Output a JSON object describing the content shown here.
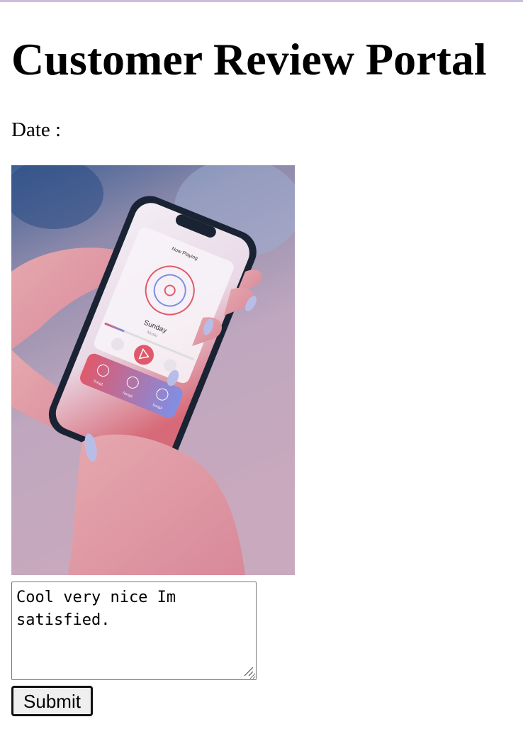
{
  "page": {
    "title": "Customer Review Portal",
    "date_label": "Date :",
    "date_value": ""
  },
  "product_image": {
    "alt": "Hands holding a smartphone showing a music player",
    "screen": {
      "header": "Now Playing",
      "song_title": "Sunday",
      "song_subtitle": "Music",
      "tabs": [
        "Song1",
        "Song2",
        "Song3"
      ]
    },
    "colors": {
      "accent": "#e0596b",
      "accent2": "#7f8fe6",
      "bg_top": "#3e5f93",
      "bg_mid": "#bfa7bf"
    }
  },
  "review": {
    "text": "Cool very nice Im satisfied.",
    "misspelled_word": "Im"
  },
  "form": {
    "submit_label": "Submit"
  }
}
